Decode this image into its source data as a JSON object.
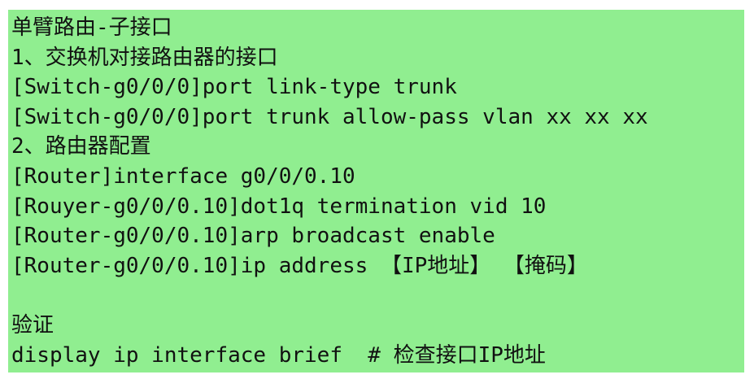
{
  "document": {
    "title": "单臂路由-子接口",
    "lines": [
      "1、交换机对接路由器的接口",
      "[Switch-g0/0/0]port link-type trunk",
      "[Switch-g0/0/0]port trunk allow-pass vlan xx xx xx",
      "2、路由器配置",
      "[Router]interface g0/0/0.10",
      "[Rouyer-g0/0/0.10]dot1q termination vid 10",
      "[Router-g0/0/0.10]arp broadcast enable",
      "[Router-g0/0/0.10]ip address 【IP地址】 【掩码】",
      "",
      "验证",
      "display ip interface brief  # 检查接口IP地址"
    ]
  },
  "colors": {
    "panel_background": "#90ee90",
    "text": "#111111"
  }
}
